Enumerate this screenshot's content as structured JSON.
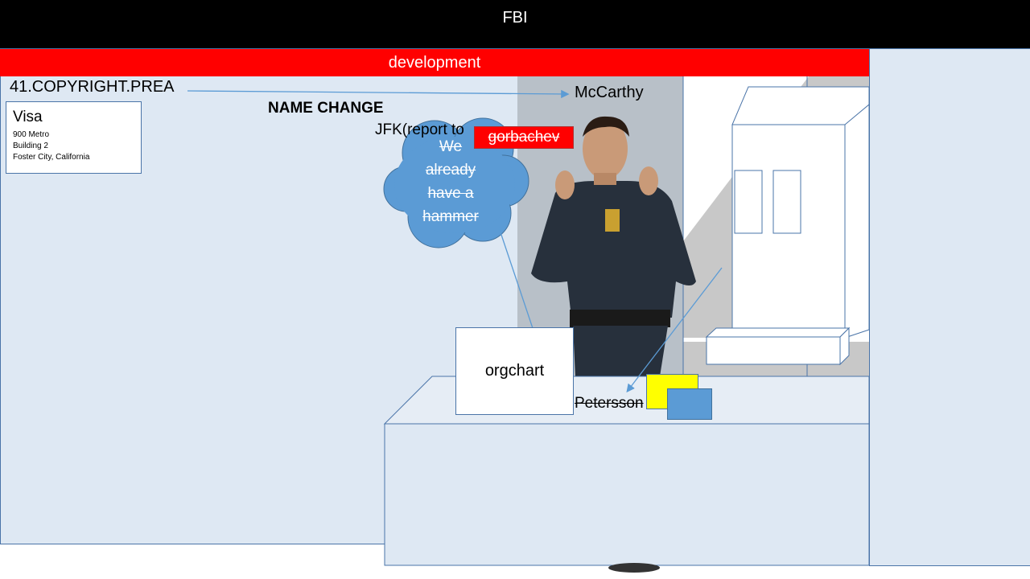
{
  "header": {
    "title": "FBI"
  },
  "banner": {
    "label": "development"
  },
  "labels": {
    "copyright": "41.COPYRIGHT.PREA",
    "mccarthy": "McCarthy",
    "name_change": "NAME CHANGE",
    "jfk": "JFK(report to",
    "gorbachev": "gorbachev",
    "orgchart": "orgchart",
    "petersson": "Petersson"
  },
  "visa_card": {
    "title": "Visa",
    "lines": [
      "900 Metro",
      "Building 2",
      "Foster City, California"
    ]
  },
  "cloud": {
    "lines": [
      "We",
      "already",
      "have a",
      "hammer"
    ]
  },
  "colors": {
    "banner": "#ff0000",
    "background": "#dee8f3",
    "cloud": "#5b9bd5",
    "yellow": "#ffff00"
  }
}
